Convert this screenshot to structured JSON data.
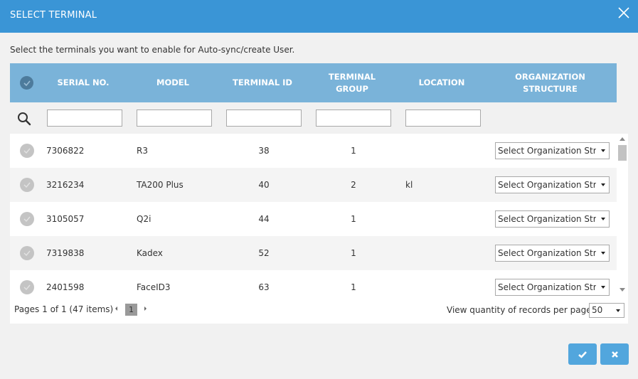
{
  "dialog": {
    "title": "SELECT TERMINAL",
    "instructions": "Select the terminals you want to enable for Auto-sync/create User."
  },
  "columns": {
    "serial_no": "SERIAL NO.",
    "model": "MODEL",
    "terminal_id": "TERMINAL ID",
    "terminal_group_line1": "TERMINAL",
    "terminal_group_line2": "GROUP",
    "location": "LOCATION",
    "organization_structure": "ORGANIZATION STRUCTURE"
  },
  "filters": {
    "serial_no": "",
    "model": "",
    "terminal_id": "",
    "terminal_group": "",
    "location": ""
  },
  "rows": [
    {
      "serial_no": "7306822",
      "model": "R3",
      "terminal_id": "38",
      "terminal_group": "1",
      "location": "",
      "org_structure": "Select Organization Structure"
    },
    {
      "serial_no": "3216234",
      "model": "TA200 Plus",
      "terminal_id": "40",
      "terminal_group": "2",
      "location": "kl",
      "org_structure": "Select Organization Structure"
    },
    {
      "serial_no": "3105057",
      "model": "Q2i",
      "terminal_id": "44",
      "terminal_group": "1",
      "location": "",
      "org_structure": "Select Organization Structure"
    },
    {
      "serial_no": "7319838",
      "model": "Kadex",
      "terminal_id": "52",
      "terminal_group": "1",
      "location": "",
      "org_structure": "Select Organization Structure"
    },
    {
      "serial_no": "2401598",
      "model": "FaceID3",
      "terminal_id": "63",
      "terminal_group": "1",
      "location": "",
      "org_structure": "Select Organization Structure"
    }
  ],
  "pager": {
    "info": "Pages 1 of 1 (47 items)",
    "current_page": "1",
    "per_page_label": "View quantity of records per page",
    "per_page_value": "50"
  },
  "colors": {
    "header_bar": "#3a95d6",
    "grid_header": "#7ab3d9",
    "button": "#52a6dd"
  },
  "icons": {
    "close": "close-icon",
    "search": "search-icon",
    "check": "check-icon",
    "cancel": "x-icon"
  }
}
